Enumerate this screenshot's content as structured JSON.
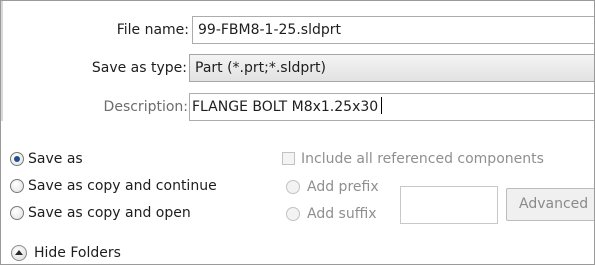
{
  "dialog": {
    "file_name_label": "File name:",
    "file_name_value": "99-FBM8-1-25.sldprt",
    "save_as_type_label": "Save as type:",
    "save_as_type_value": "Part (*.prt;*.sldprt)",
    "description_label": "Description:",
    "description_value": "FLANGE BOLT M8x1.25x30"
  },
  "save_options": {
    "save_as": "Save as",
    "save_as_copy_continue": "Save as copy and continue",
    "save_as_copy_open": "Save as copy and open",
    "selected": "save_as"
  },
  "reference_options": {
    "include_all": "Include all referenced components",
    "add_prefix": "Add prefix",
    "add_suffix": "Add suffix",
    "advanced": "Advanced"
  },
  "footer": {
    "hide_folders": "Hide Folders"
  },
  "icons": {
    "hide_folders": "chevron-up-circle-icon"
  }
}
